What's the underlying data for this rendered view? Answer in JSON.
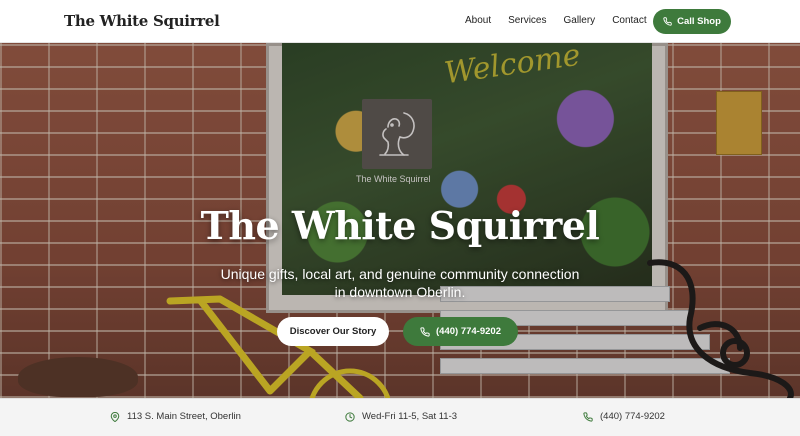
{
  "header": {
    "logo": "The White Squirrel",
    "nav": [
      "About",
      "Services",
      "Gallery",
      "Contact"
    ],
    "call_button": "Call Shop",
    "call_icon": "phone-icon",
    "accent_color": "#3e7a3c"
  },
  "hero": {
    "window_text": "Welcome",
    "logo_caption": "The White Squirrel",
    "title": "The White Squirrel",
    "subtitle_line1": "Unique gifts, local art, and genuine community connection",
    "subtitle_line2": "in downtown Oberlin.",
    "story_button": "Discover Our Story",
    "phone_button": "(440) 774-9202",
    "phone_icon": "phone-icon"
  },
  "infobar": {
    "address": "113 S. Main Street, Oberlin",
    "address_icon": "map-pin-icon",
    "hours": "Wed-Fri 11-5, Sat 11-3",
    "hours_icon": "clock-icon",
    "phone": "(440) 774-9202",
    "phone_icon": "phone-icon",
    "icon_color": "#3e7a3c"
  }
}
